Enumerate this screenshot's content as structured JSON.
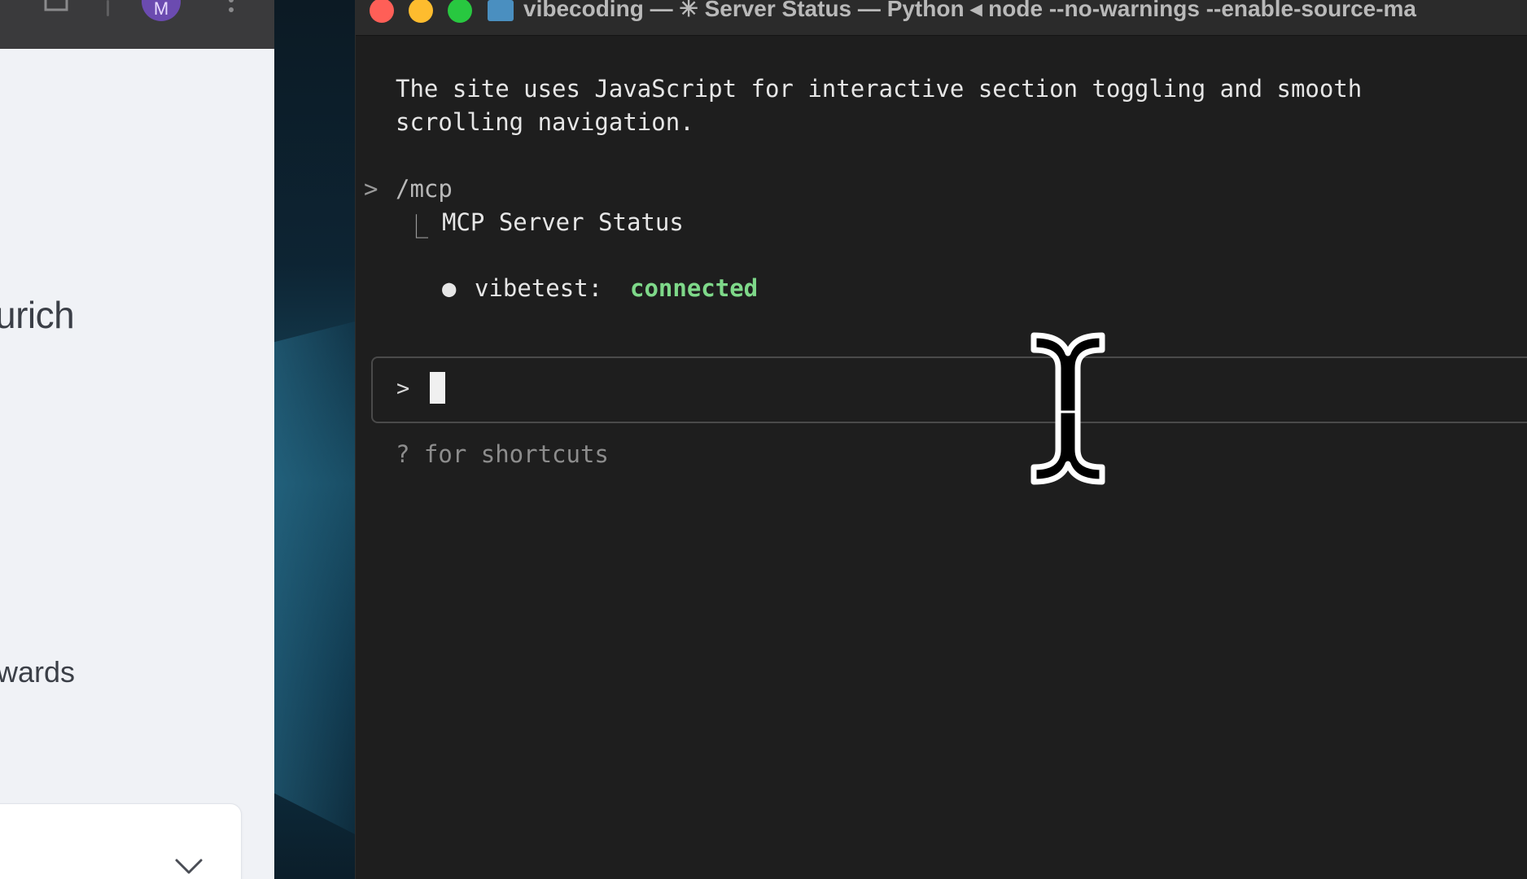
{
  "browser": {
    "avatar_initial": "M",
    "heading_fragment": "urich",
    "text_fragment": "wards"
  },
  "terminal": {
    "window_title": "vibecoding — ✳ Server Status — Python ◂ node --no-warnings --enable-source-ma",
    "description_lines": [
      "The site uses JavaScript for interactive section toggling and smooth",
      "scrolling navigation."
    ],
    "prompt_marker": ">",
    "command": "/mcp",
    "tree_branch": "⎿",
    "mcp_title": "MCP Server Status",
    "bullet": "●",
    "server": {
      "name": "vibetest:",
      "status": "connected",
      "status_color": "#7ed889"
    },
    "input": {
      "prompt": ">",
      "value": ""
    },
    "shortcuts_hint": "? for shortcuts"
  },
  "colors": {
    "terminal_bg": "#1e1e1e",
    "traffic_close": "#ff5f57",
    "traffic_minimize": "#febc2e",
    "traffic_zoom": "#28c840"
  },
  "icons": [
    "extension-icon",
    "avatar",
    "more-options-icon",
    "chevron-down-icon",
    "folder-icon",
    "i-beam-cursor-icon"
  ]
}
